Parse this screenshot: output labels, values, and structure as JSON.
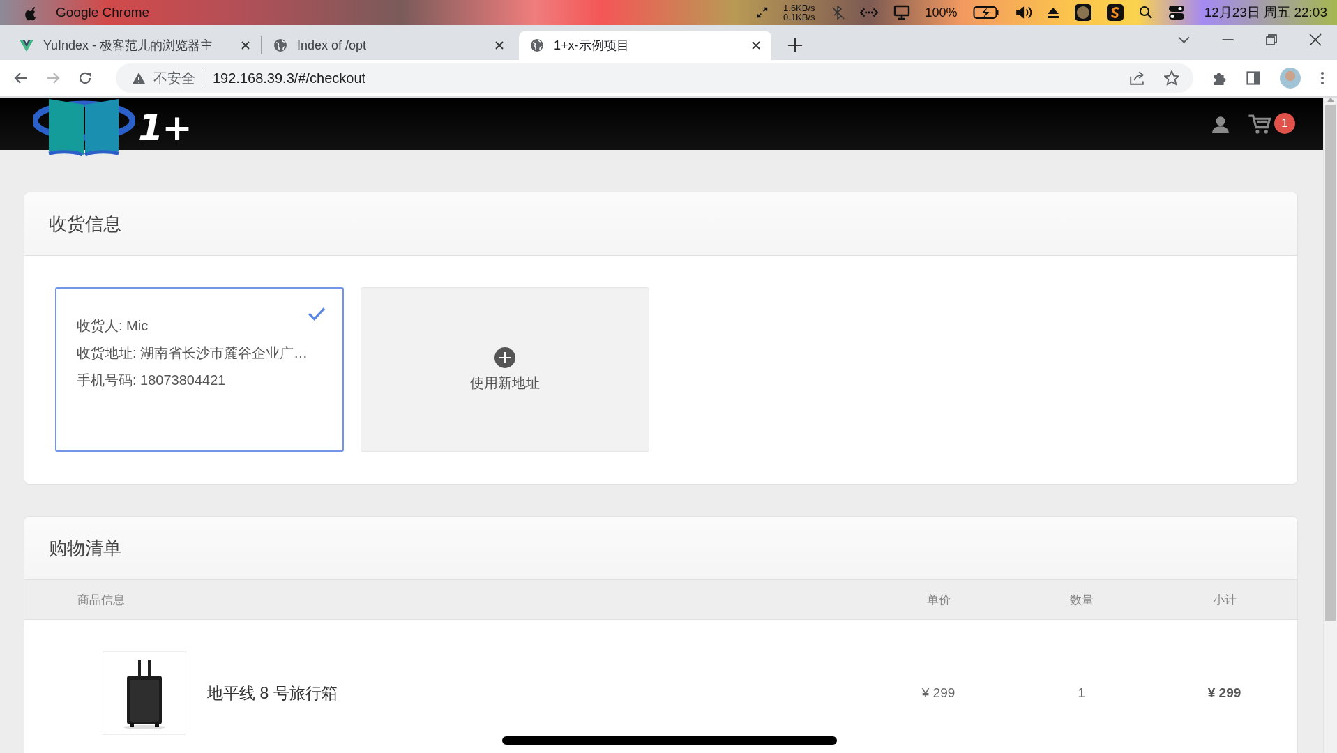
{
  "menubar": {
    "app": "Google Chrome",
    "net_up": "1.6KB/s",
    "net_down": "0.1KB/s",
    "battery": "100%",
    "clock": "12月23日 周五 22:03"
  },
  "tabs": [
    {
      "title": "YuIndex - 极客范儿的浏览器主",
      "kind": "vue",
      "selected": false
    },
    {
      "title": "Index of /opt",
      "kind": "globe",
      "selected": false
    },
    {
      "title": "1+x-示例项目",
      "kind": "globe",
      "selected": true
    }
  ],
  "address_bar": {
    "security": "不安全",
    "url": "192.168.39.3/#/checkout"
  },
  "header": {
    "logo_text": "1+",
    "cart_count": "1"
  },
  "shipping": {
    "title": "收货信息",
    "addresses": [
      {
        "lines": [
          "收货人: Mic",
          "收货地址: 湖南省长沙市麓谷企业广…",
          "手机号码: 18073804421"
        ],
        "selected": true
      }
    ],
    "new_address": "使用新地址"
  },
  "cart": {
    "title": "购物清单",
    "columns": [
      "商品信息",
      "单价",
      "数量",
      "小计"
    ],
    "items": [
      {
        "name": "地平线 8 号旅行箱",
        "price": "¥ 299",
        "quantity": "1",
        "subtotal": "¥ 299"
      }
    ]
  }
}
